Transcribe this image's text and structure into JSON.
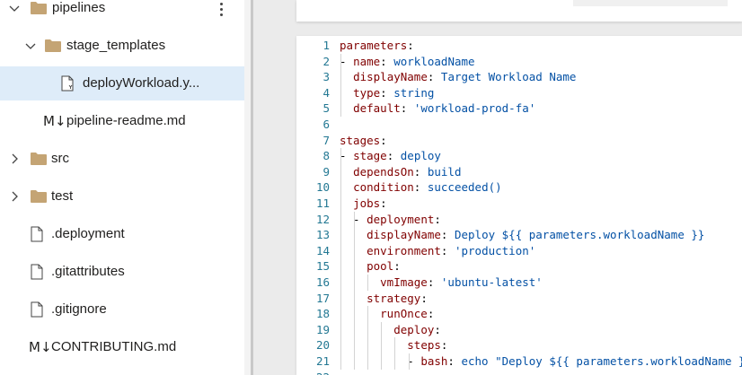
{
  "explorer": {
    "items": [
      {
        "label": "pipelines",
        "kind": "folder",
        "expanded": true,
        "has_chevron": true
      },
      {
        "label": "stage_templates",
        "kind": "folder",
        "expanded": true,
        "has_chevron": true
      },
      {
        "label": "deployWorkload.y...",
        "kind": "yaml-file",
        "selected": true
      },
      {
        "label": "pipeline-readme.md",
        "kind": "markdown-file",
        "icon_text": "M↓"
      },
      {
        "label": "src",
        "kind": "folder",
        "expanded": false,
        "has_chevron": true
      },
      {
        "label": "test",
        "kind": "folder",
        "expanded": false,
        "has_chevron": true
      },
      {
        "label": ".deployment",
        "kind": "file"
      },
      {
        "label": ".gitattributes",
        "kind": "file"
      },
      {
        "label": ".gitignore",
        "kind": "file"
      },
      {
        "label": "CONTRIBUTING.md",
        "kind": "markdown-file",
        "icon_text": "M↓"
      }
    ]
  },
  "editor": {
    "lines": [
      {
        "n": "1",
        "indent": "",
        "key": "parameters",
        "sep": ":",
        "val": ""
      },
      {
        "n": "2",
        "indent": "- ",
        "key": "name",
        "sep": ": ",
        "val": "workloadName"
      },
      {
        "n": "3",
        "indent": "  ",
        "key": "displayName",
        "sep": ": ",
        "val": "Target Workload Name"
      },
      {
        "n": "4",
        "indent": "  ",
        "key": "type",
        "sep": ": ",
        "val": "string"
      },
      {
        "n": "5",
        "indent": "  ",
        "key": "default",
        "sep": ": ",
        "val": "'workload-prod-fa'"
      },
      {
        "n": "6",
        "indent": "",
        "key": "",
        "sep": "",
        "val": ""
      },
      {
        "n": "7",
        "indent": "",
        "key": "stages",
        "sep": ":",
        "val": ""
      },
      {
        "n": "8",
        "indent": "- ",
        "key": "stage",
        "sep": ": ",
        "val": "deploy"
      },
      {
        "n": "9",
        "indent": "  ",
        "key": "dependsOn",
        "sep": ": ",
        "val": "build"
      },
      {
        "n": "10",
        "indent": "  ",
        "key": "condition",
        "sep": ": ",
        "val": "succeeded()"
      },
      {
        "n": "11",
        "indent": "  ",
        "key": "jobs",
        "sep": ":",
        "val": ""
      },
      {
        "n": "12",
        "indent": "  - ",
        "key": "deployment",
        "sep": ":",
        "val": ""
      },
      {
        "n": "13",
        "indent": "    ",
        "key": "displayName",
        "sep": ": ",
        "val": "Deploy ${{ parameters.workloadName }}"
      },
      {
        "n": "14",
        "indent": "    ",
        "key": "environment",
        "sep": ": ",
        "val": "'production'"
      },
      {
        "n": "15",
        "indent": "    ",
        "key": "pool",
        "sep": ":",
        "val": ""
      },
      {
        "n": "16",
        "indent": "      ",
        "key": "vmImage",
        "sep": ": ",
        "val": "'ubuntu-latest'"
      },
      {
        "n": "17",
        "indent": "    ",
        "key": "strategy",
        "sep": ":",
        "val": ""
      },
      {
        "n": "18",
        "indent": "      ",
        "key": "runOnce",
        "sep": ":",
        "val": ""
      },
      {
        "n": "19",
        "indent": "        ",
        "key": "deploy",
        "sep": ":",
        "val": ""
      },
      {
        "n": "20",
        "indent": "          ",
        "key": "steps",
        "sep": ":",
        "val": ""
      },
      {
        "n": "21",
        "indent": "          - ",
        "key": "bash",
        "sep": ": ",
        "val": "echo \"Deploy ${{ parameters.workloadName }}"
      },
      {
        "n": "22",
        "indent": "",
        "key": "",
        "sep": "",
        "val": ""
      }
    ]
  }
}
